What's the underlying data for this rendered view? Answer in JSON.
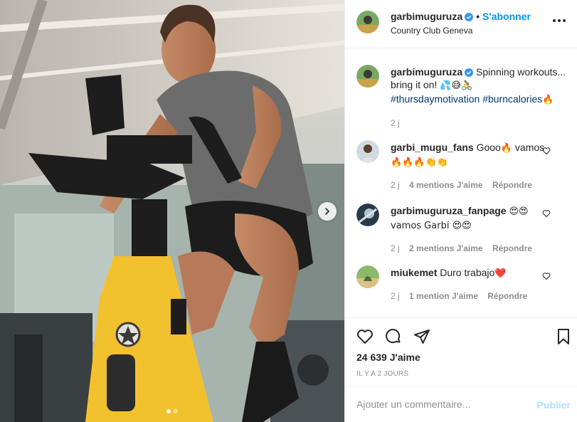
{
  "header": {
    "username": "garbimuguruza",
    "separator": "•",
    "follow_label": "S'abonner",
    "location": "Country Club Geneva"
  },
  "caption": {
    "username": "garbimuguruza",
    "text": "Spinning workouts... bring it on!",
    "emojis": "💦😅🚴",
    "hashtag1": "#thursdaymotivation",
    "hashtag2": "#burncalories",
    "hashtag2_emoji": "🔥",
    "age": "2 j"
  },
  "comments": [
    {
      "username": "garbi_mugu_fans",
      "text": "Gooo",
      "text_emoji": "🔥",
      "text_after": " vamos",
      "text_line2": "🔥🔥🔥👏👏",
      "age": "2 j",
      "likes": "4 mentions J'aime",
      "reply": "Répondre"
    },
    {
      "username": "garbimuguruza_fanpage",
      "text": "",
      "text_emoji": "😍😍",
      "text_after": "",
      "text_line2": "vamos Garbi 😍😍",
      "age": "2 j",
      "likes": "2 mentions J'aime",
      "reply": "Répondre"
    },
    {
      "username": "miukemet",
      "text": "Duro trabajo",
      "text_emoji": "❤️",
      "text_after": "",
      "text_line2": "",
      "age": "2 j",
      "likes": "1 mention J'aime",
      "reply": "Répondre"
    }
  ],
  "actions": {
    "likes": "24 639 J'aime",
    "time": "IL Y A 2 JOURS"
  },
  "add_comment": {
    "placeholder": "Ajouter un commentaire...",
    "publish_label": "Publier"
  },
  "colors": {
    "link_blue": "#0095f6",
    "hashtag": "#00376b",
    "muted": "#8e8e8e",
    "bike_yellow": "#f2c12e"
  },
  "carousel": {
    "slide_count": 2,
    "active_index": 0
  }
}
